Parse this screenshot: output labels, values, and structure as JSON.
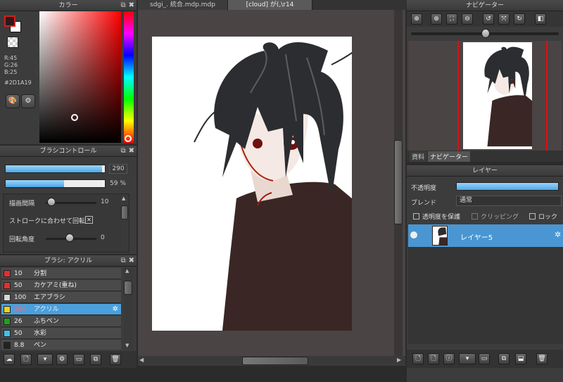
{
  "tabs": [
    {
      "label": "sdgi_. 統合.mdp.mdp"
    },
    {
      "label": "[cloud] が(,\\r14"
    }
  ],
  "color_panel": {
    "title": "カラー",
    "r": "R:45",
    "g": "G:26",
    "b": "B:25",
    "hex": "#2D1A19"
  },
  "brush_control": {
    "title": "ブラシコントロール",
    "size_value": "290",
    "size_fraction": 0.97,
    "opacity_value": "59 %",
    "opacity_fraction": 0.59,
    "interval_label": "描画間隔",
    "interval_value": "10",
    "stroke_label": "ストロークに合わせて回転",
    "rotation_label": "回転角度",
    "rotation_value": "0"
  },
  "brush_list": {
    "title": "ブラシ: アクリル",
    "items": [
      {
        "size": "10",
        "name": "分割",
        "color": "#e03030"
      },
      {
        "size": "50",
        "name": "カケアミ(重ね)",
        "color": "#e03030"
      },
      {
        "size": "100",
        "name": "エアブラシ",
        "color": "#d8d8d8"
      },
      {
        "size": "290",
        "name": "アクリル",
        "color": "#f0d020"
      },
      {
        "size": "26",
        "name": "ふちペン",
        "color": "#20a020"
      },
      {
        "size": "50",
        "name": "水彩",
        "color": "#40c0f0"
      },
      {
        "size": "8.8",
        "name": "ペン",
        "color": "#222222"
      }
    ],
    "selected_index": 3
  },
  "navigator": {
    "title": "ナビゲーター",
    "tabs": [
      {
        "label": "資料"
      },
      {
        "label": "ナビゲーター"
      }
    ]
  },
  "layer_panel": {
    "title": "レイヤー",
    "opacity_label": "不透明度",
    "blend_label": "ブレンド",
    "blend_value": "通常",
    "protect_label": "透明度を保護",
    "clipping_label": "クリッピング",
    "lock_label": "ロック",
    "layer_name": "レイヤー5"
  },
  "colors": {
    "accent": "#4aa0dc",
    "panel_bg": "#3c3c3c",
    "canvas_bg": "#4a4444"
  }
}
